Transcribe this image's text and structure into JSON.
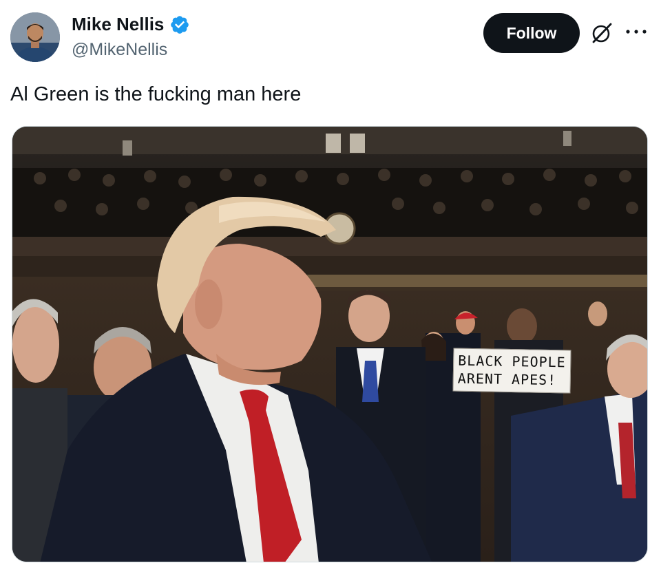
{
  "author": {
    "display_name": "Mike Nellis",
    "handle": "@MikeNellis",
    "verified": true,
    "verified_color": "#1d9bf0"
  },
  "actions": {
    "follow_label": "Follow",
    "grok_icon": "grok-slash-circle-icon",
    "more_icon": "ellipsis-icon"
  },
  "tweet": {
    "text": "Al Green is the fucking man here"
  },
  "media": {
    "sign_line1": "BLACK PEOPLE",
    "sign_line2": "ARENT APES!"
  },
  "colors": {
    "text_primary": "#0f1419",
    "text_secondary": "#536471",
    "button_bg": "#0f1419"
  }
}
